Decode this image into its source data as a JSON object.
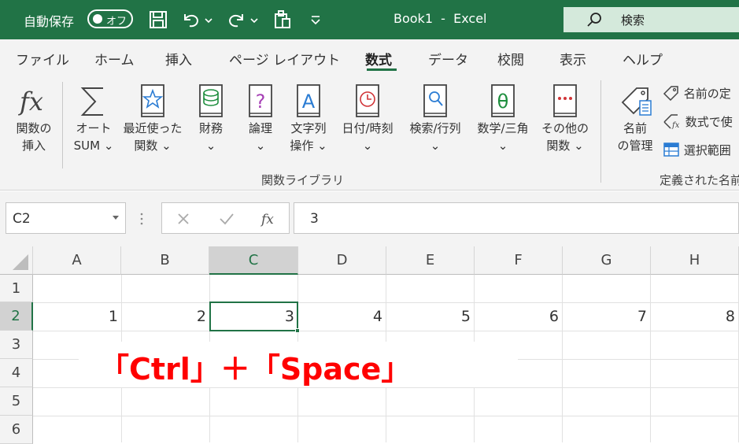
{
  "titlebar": {
    "autosave_label": "自動保存",
    "autosave_state": "オフ",
    "document_title": "Book1  -  Excel",
    "search_label": "検索"
  },
  "tabs": [
    "ファイル",
    "ホーム",
    "挿入",
    "ページ レイアウト",
    "数式",
    "データ",
    "校閲",
    "表示",
    "ヘルプ"
  ],
  "active_tab": "数式",
  "ribbon": {
    "insert_function": [
      "関数の",
      "挿入"
    ],
    "autosum": [
      "オート",
      "SUM ⌄"
    ],
    "recent": [
      "最近使った",
      "関数 ⌄"
    ],
    "financial": [
      "財務",
      "⌄"
    ],
    "logical": [
      "論理",
      "⌄"
    ],
    "text": [
      "文字列",
      "操作 ⌄"
    ],
    "datetime": [
      "日付/時刻",
      "⌄"
    ],
    "lookup": [
      "検索/行列",
      "⌄"
    ],
    "math": [
      "数学/三角",
      "⌄"
    ],
    "more": [
      "その他の",
      "関数 ⌄"
    ],
    "group1_label": "関数ライブラリ",
    "name_manager": [
      "名前",
      "の管理"
    ],
    "define_name": "名前の定",
    "use_in_formula": "数式で使",
    "create_from_selection": "選択範囲",
    "group2_label": "定義された名前"
  },
  "formula_bar": {
    "name_box": "C2",
    "value": "3"
  },
  "grid": {
    "columns": [
      "A",
      "B",
      "C",
      "D",
      "E",
      "F",
      "G",
      "H"
    ],
    "selected_column": "C",
    "rows": [
      "1",
      "2",
      "3",
      "4",
      "5",
      "6"
    ],
    "selected_row": "2",
    "row2_values": [
      "1",
      "2",
      "3",
      "4",
      "5",
      "6",
      "7",
      "8"
    ]
  },
  "overlay_text": "「Ctrl」＋「Space」",
  "colors": {
    "excel_green": "#217346",
    "overlay_red": "#ff0000"
  }
}
